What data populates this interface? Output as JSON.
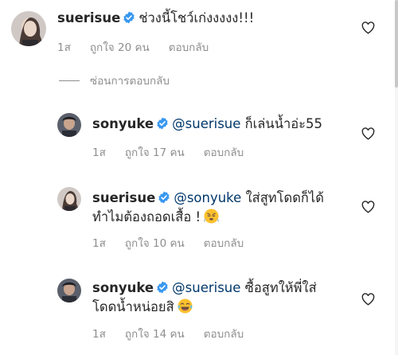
{
  "comments": [
    {
      "username": "suerisue",
      "mention": "",
      "text_line1": "ช่วงนี้โชว์เก่งงงงง!!!",
      "text_line2": "",
      "time": "1ส",
      "likes": "ถูกใจ 20 คน",
      "reply": "ตอบกลับ"
    },
    {
      "username": "sonyuke",
      "mention": "@suerisue",
      "text_line1": "ก็เล่นน้ำอ่ะ55",
      "text_line2": "",
      "time": "1ส",
      "likes": "ถูกใจ 17 คน",
      "reply": "ตอบกลับ"
    },
    {
      "username": "suerisue",
      "mention": "@sonyuke",
      "text_line1": "ใส่สูทโดดก็ได้",
      "text_line2": "ทำไมต้องถอดเสื้อ !",
      "emoji": "huffing-face-emoji",
      "time": "1ส",
      "likes": "ถูกใจ 10 คน",
      "reply": "ตอบกลับ"
    },
    {
      "username": "sonyuke",
      "mention": "@suerisue",
      "text_line1": "ซื้อสูทให้พี่ใส่",
      "text_line2": "โดดน้ำหน่อยสิ",
      "emoji": "tears-of-joy-emoji",
      "time": "1ส",
      "likes": "ถูกใจ 14 คน",
      "reply": "ตอบกลับ"
    }
  ],
  "hide_replies_label": "ซ่อนการตอบกลับ",
  "colors": {
    "text": "#262626",
    "mention": "#00376b",
    "meta": "#8e8e8e",
    "verified": "#3897f0"
  },
  "icons": [
    "verified-badge-icon",
    "heart-icon"
  ]
}
